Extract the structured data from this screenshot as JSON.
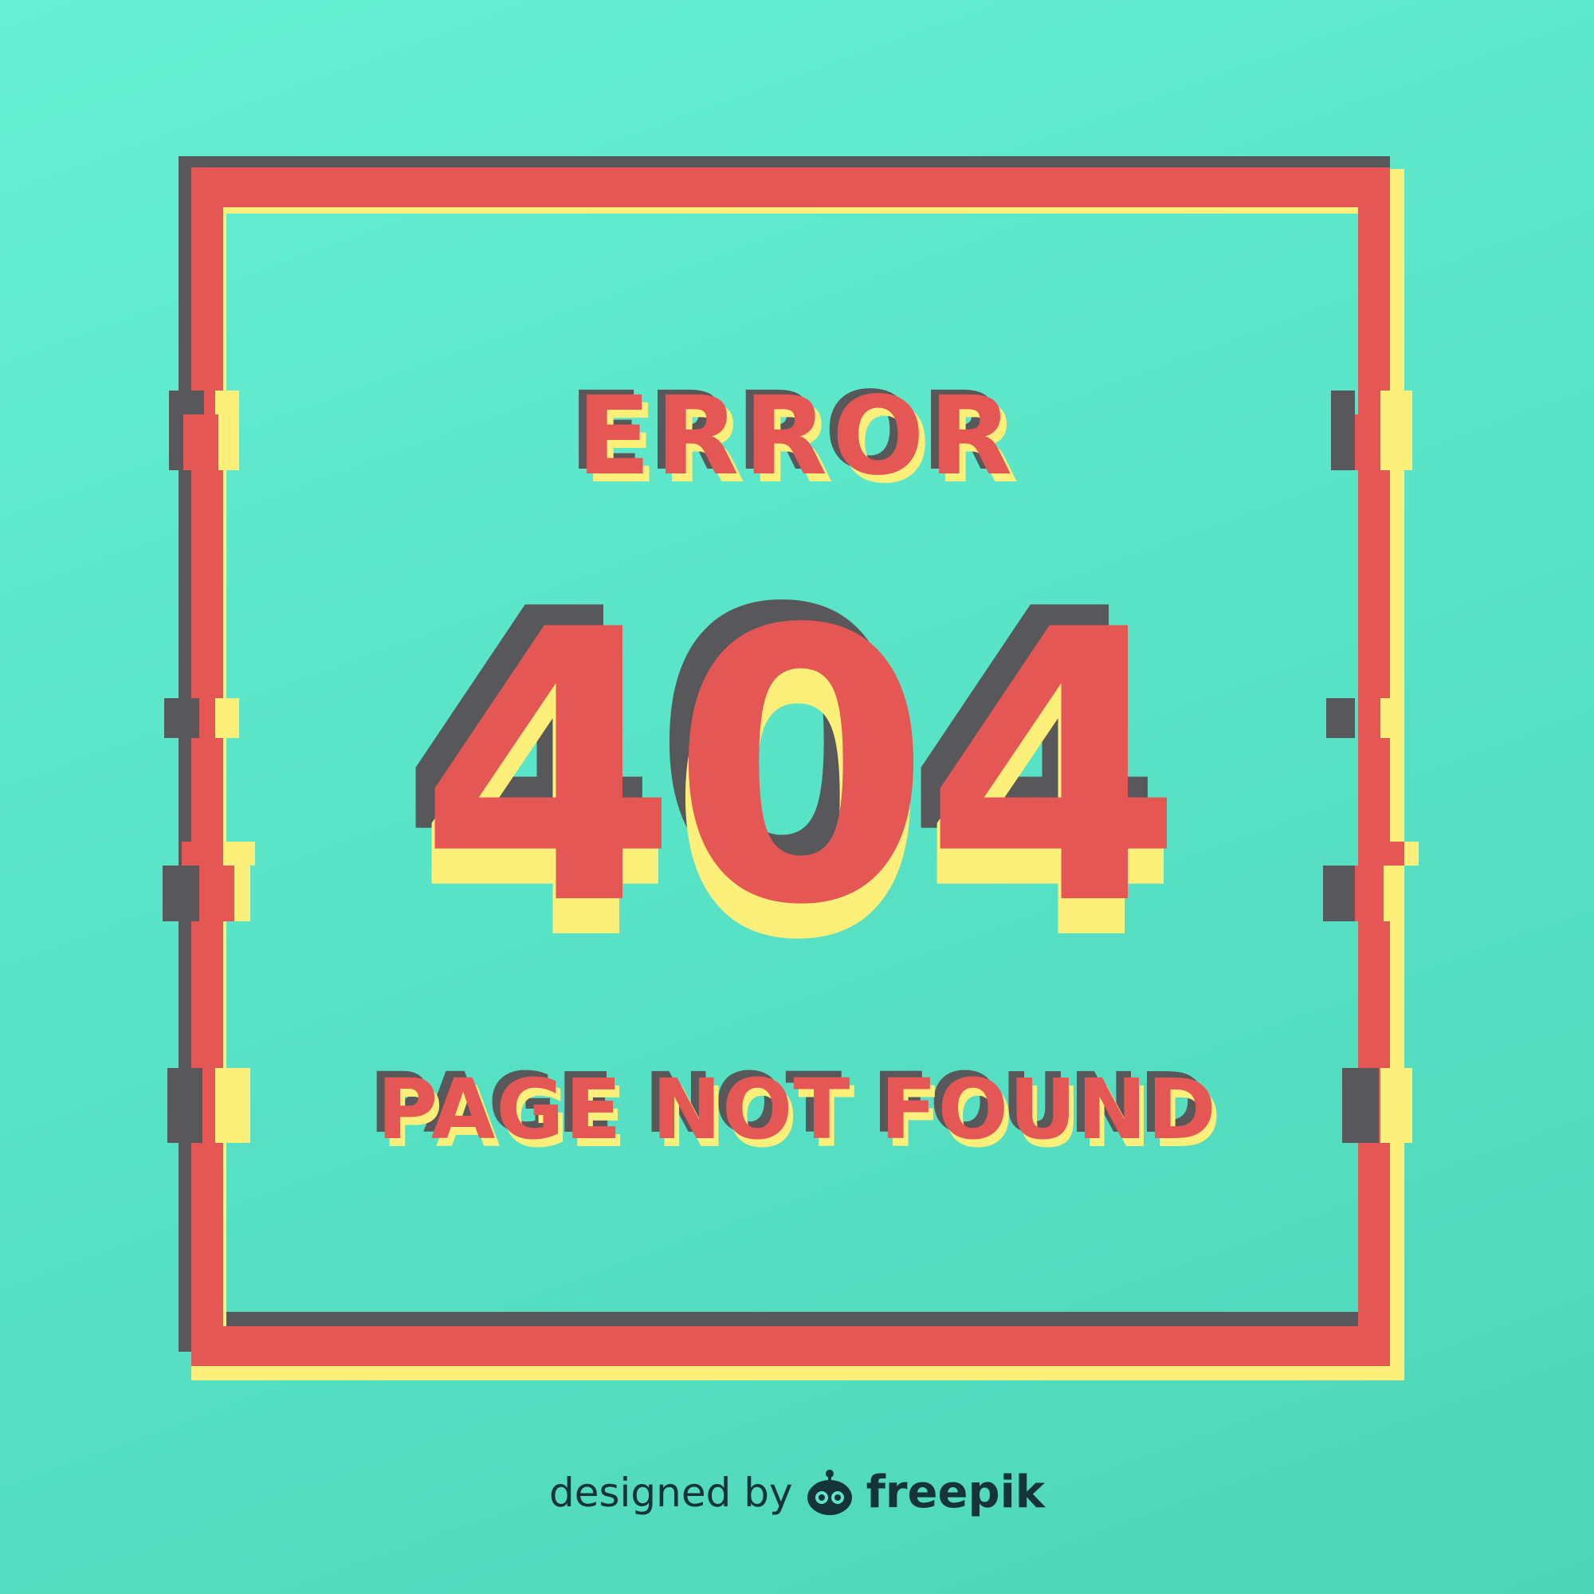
{
  "heading": "ERROR",
  "code": "404",
  "message": "PAGE NOT FOUND",
  "credit": {
    "prefix": "designed by",
    "brand": "freepik",
    "logo_icon": "freepik-logo-icon"
  },
  "colors": {
    "background": "#5de6ca",
    "red": "#e55755",
    "yellow": "#fcef7a",
    "dark": "#58585a",
    "credit_text": "#16333a"
  }
}
